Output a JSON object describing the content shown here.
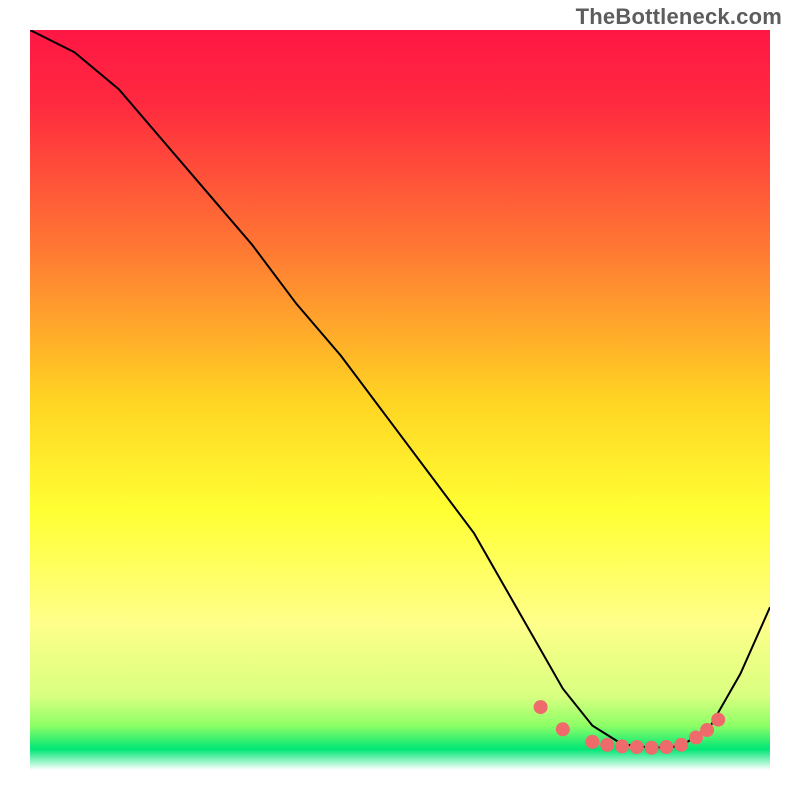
{
  "watermark": "TheBottleneck.com",
  "chart_data": {
    "type": "line",
    "title": "",
    "xlabel": "",
    "ylabel": "",
    "xlim": [
      0,
      100
    ],
    "ylim": [
      0,
      100
    ],
    "grid": false,
    "legend": false,
    "background_gradient": {
      "stops": [
        {
          "pos": 0.0,
          "color": "#ff1744"
        },
        {
          "pos": 0.1,
          "color": "#ff2a3f"
        },
        {
          "pos": 0.3,
          "color": "#ff7a33"
        },
        {
          "pos": 0.5,
          "color": "#ffd423"
        },
        {
          "pos": 0.65,
          "color": "#ffff33"
        },
        {
          "pos": 0.8,
          "color": "#ffff8a"
        },
        {
          "pos": 0.9,
          "color": "#d9ff80"
        },
        {
          "pos": 0.94,
          "color": "#8dff66"
        },
        {
          "pos": 0.972,
          "color": "#00e676"
        },
        {
          "pos": 1.0,
          "color": "#ffffff"
        }
      ]
    },
    "series": [
      {
        "name": "bottleneck-curve",
        "stroke": "#000000",
        "stroke_width": 2,
        "x": [
          0,
          6,
          12,
          18,
          24,
          30,
          36,
          42,
          48,
          54,
          60,
          64,
          68,
          72,
          76,
          80,
          84,
          88,
          92,
          96,
          100
        ],
        "y": [
          100,
          97,
          92,
          85,
          78,
          71,
          63,
          56,
          48,
          40,
          32,
          25,
          18,
          11,
          6,
          3.5,
          3,
          3.2,
          6,
          13,
          22
        ]
      }
    ],
    "markers": [
      {
        "name": "scatter-dots",
        "color": "#ef6a6a",
        "radius": 7,
        "x": [
          69,
          72,
          76,
          78,
          80,
          82,
          84,
          86,
          88,
          90,
          91.5,
          93
        ],
        "y": [
          8.5,
          5.5,
          3.8,
          3.4,
          3.2,
          3.1,
          3.0,
          3.1,
          3.4,
          4.4,
          5.4,
          6.8
        ]
      }
    ]
  }
}
